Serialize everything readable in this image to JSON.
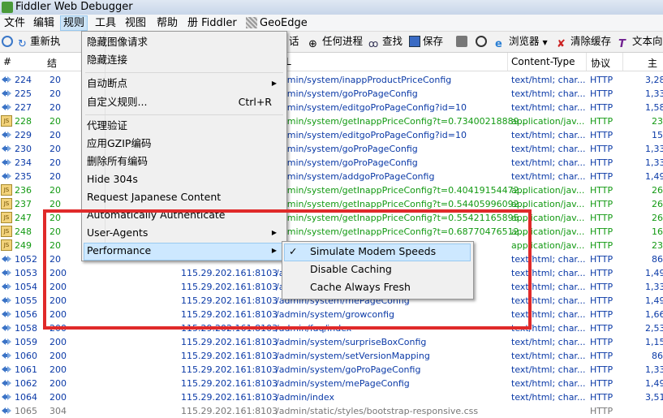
{
  "window": {
    "title": "Fiddler Web Debugger"
  },
  "menubar": {
    "items": [
      "文件",
      "编辑",
      "规则",
      "工具",
      "视图",
      "帮助",
      "册 Fiddler",
      "GeoEdge"
    ]
  },
  "toolbar": {
    "items": [
      "重新执",
      "话",
      "任何进程",
      "查找",
      "保存",
      "浏览器",
      "清除缓存",
      "文本向"
    ]
  },
  "columns": {
    "num": "#",
    "result": "结",
    "url_tail": "L",
    "content_type": "Content-Type",
    "protocol": "协议",
    "body": "主"
  },
  "rules_menu": {
    "items": [
      "隐藏图像请求",
      "隐藏连接",
      "自动断点",
      "自定义规则...",
      "代理验证",
      "应用GZIP编码",
      "删除所有编码",
      "Hide 304s",
      "Request Japanese Content",
      "Automatically Authenticate",
      "User-Agents",
      "Performance"
    ],
    "shortcut": "Ctrl+R"
  },
  "performance_menu": {
    "items": [
      "Simulate Modem Speeds",
      "Disable Caching",
      "Cache Always Fresh"
    ],
    "check": "✓"
  },
  "sessions": [
    {
      "num": "224",
      "res": "20",
      "host": "",
      "url": "admin/system/inappProductPriceConfig",
      "ct": "text/html; char...",
      "pr": "HTTP",
      "sz": "3,28",
      "color": "blue",
      "icon": "arrow"
    },
    {
      "num": "225",
      "res": "20",
      "host": "",
      "url": "admin/system/goProPageConfig",
      "ct": "text/html; char...",
      "pr": "HTTP",
      "sz": "1,33",
      "color": "blue",
      "icon": "arrow"
    },
    {
      "num": "227",
      "res": "20",
      "host": "",
      "url": "admin/system/editgoProPageConfig?id=10",
      "ct": "text/html; char...",
      "pr": "HTTP",
      "sz": "1,58",
      "color": "blue",
      "icon": "arrow"
    },
    {
      "num": "228",
      "res": "20",
      "host": "",
      "url": "admin/system/getInappPriceConfig?t=0.73400218889...",
      "ct": "application/jav...",
      "pr": "HTTP",
      "sz": "23",
      "color": "green",
      "icon": "js"
    },
    {
      "num": "229",
      "res": "20",
      "host": "",
      "url": "admin/system/editgoProPageConfig?id=10",
      "ct": "text/html; char...",
      "pr": "HTTP",
      "sz": "15",
      "color": "blue",
      "icon": "arrow"
    },
    {
      "num": "230",
      "res": "20",
      "host": "",
      "url": "admin/system/goProPageConfig",
      "ct": "text/html; char...",
      "pr": "HTTP",
      "sz": "1,33",
      "color": "blue",
      "icon": "arrow"
    },
    {
      "num": "234",
      "res": "20",
      "host": "",
      "url": "admin/system/goProPageConfig",
      "ct": "text/html; char...",
      "pr": "HTTP",
      "sz": "1,33",
      "color": "blue",
      "icon": "arrow"
    },
    {
      "num": "235",
      "res": "20",
      "host": "",
      "url": "admin/system/addgoProPageConfig",
      "ct": "text/html; char...",
      "pr": "HTTP",
      "sz": "1,49",
      "color": "blue",
      "icon": "arrow"
    },
    {
      "num": "236",
      "res": "20",
      "host": "",
      "url": "admin/system/getInappPriceConfig?t=0.40419154472...",
      "ct": "application/jav...",
      "pr": "HTTP",
      "sz": "26",
      "color": "green",
      "icon": "js"
    },
    {
      "num": "237",
      "res": "20",
      "host": "",
      "url": "admin/system/getInappPriceConfig?t=0.54405996092...",
      "ct": "application/jav...",
      "pr": "HTTP",
      "sz": "26",
      "color": "green",
      "icon": "js"
    },
    {
      "num": "247",
      "res": "20",
      "host": "",
      "url": "admin/system/getInappPriceConfig?t=0.55421165895...",
      "ct": "application/jav...",
      "pr": "HTTP",
      "sz": "26",
      "color": "green",
      "icon": "js"
    },
    {
      "num": "248",
      "res": "20",
      "host": "",
      "url": "admin/system/getInappPriceConfig?t=0.68770476512...",
      "ct": "application/jav...",
      "pr": "HTTP",
      "sz": "16",
      "color": "green",
      "icon": "js"
    },
    {
      "num": "249",
      "res": "20",
      "host": "",
      "url": "7888...",
      "ct": "application/jav...",
      "pr": "HTTP",
      "sz": "23",
      "color": "green",
      "icon": "js"
    },
    {
      "num": "1052",
      "res": "20",
      "host": "",
      "url": "",
      "ct": "text/html; char...",
      "pr": "HTTP",
      "sz": "86",
      "color": "blue",
      "icon": "arrow"
    },
    {
      "num": "1053",
      "res": "200",
      "host": "115.29.202.161:8103",
      "url": "/a",
      "ct": "text/html; char...",
      "pr": "HTTP",
      "sz": "1,49",
      "color": "blue",
      "icon": "arrow"
    },
    {
      "num": "1054",
      "res": "200",
      "host": "115.29.202.161:8103",
      "url": "/a",
      "ct": "text/html; char...",
      "pr": "HTTP",
      "sz": "1,33",
      "color": "blue",
      "icon": "arrow"
    },
    {
      "num": "1055",
      "res": "200",
      "host": "115.29.202.161:8103",
      "url": "/admin/system/mePageConfig",
      "ct": "text/html; char...",
      "pr": "HTTP",
      "sz": "1,49",
      "color": "blue",
      "icon": "arrow"
    },
    {
      "num": "1056",
      "res": "200",
      "host": "115.29.202.161:8103",
      "url": "/admin/system/growconfig",
      "ct": "text/html; char...",
      "pr": "HTTP",
      "sz": "1,66",
      "color": "blue",
      "icon": "arrow"
    },
    {
      "num": "1058",
      "res": "200",
      "host": "115.29.202.161:8103",
      "url": "/admin/faq/index",
      "ct": "text/html; char...",
      "pr": "HTTP",
      "sz": "2,53",
      "color": "blue",
      "icon": "arrow"
    },
    {
      "num": "1059",
      "res": "200",
      "host": "115.29.202.161:8103",
      "url": "/admin/system/surpriseBoxConfig",
      "ct": "text/html; char...",
      "pr": "HTTP",
      "sz": "1,15",
      "color": "blue",
      "icon": "arrow"
    },
    {
      "num": "1060",
      "res": "200",
      "host": "115.29.202.161:8103",
      "url": "/admin/system/setVersionMapping",
      "ct": "text/html; char...",
      "pr": "HTTP",
      "sz": "86",
      "color": "blue",
      "icon": "arrow"
    },
    {
      "num": "1061",
      "res": "200",
      "host": "115.29.202.161:8103",
      "url": "/admin/system/goProPageConfig",
      "ct": "text/html; char...",
      "pr": "HTTP",
      "sz": "1,33",
      "color": "blue",
      "icon": "arrow"
    },
    {
      "num": "1062",
      "res": "200",
      "host": "115.29.202.161:8103",
      "url": "/admin/system/mePageConfig",
      "ct": "text/html; char...",
      "pr": "HTTP",
      "sz": "1,49",
      "color": "blue",
      "icon": "arrow"
    },
    {
      "num": "1064",
      "res": "200",
      "host": "115.29.202.161:8103",
      "url": "/admin/index",
      "ct": "text/html; char...",
      "pr": "HTTP",
      "sz": "3,51",
      "color": "blue",
      "icon": "arrow"
    },
    {
      "num": "1065",
      "res": "304",
      "host": "115.29.202.161:8103",
      "url": "/admin/static/styles/bootstrap-responsive.css",
      "ct": "",
      "pr": "HTTP",
      "sz": "",
      "color": "grey",
      "icon": "arrow"
    }
  ],
  "colors": {
    "highlight_box": "#e02a2a",
    "link_blue": "#0b3aa7",
    "js_green": "#139a13"
  }
}
